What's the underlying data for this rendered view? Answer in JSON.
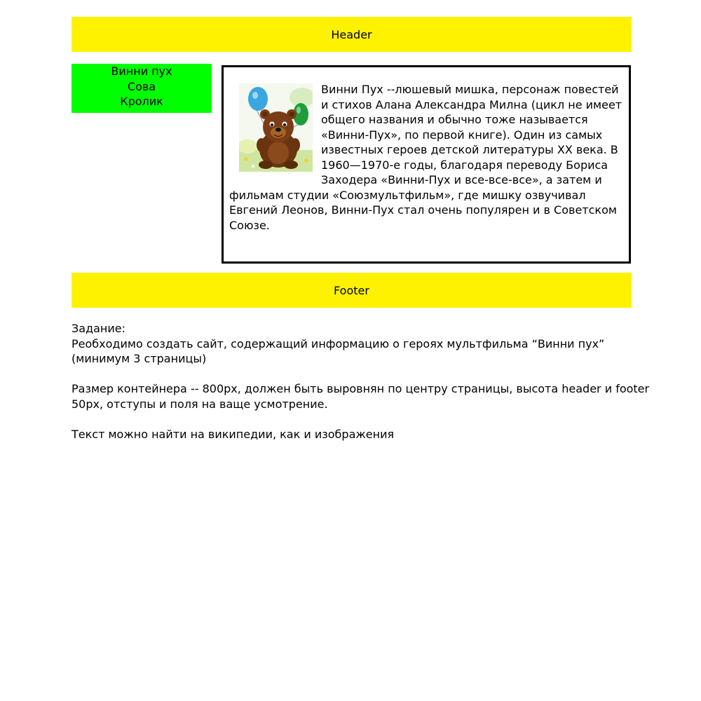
{
  "header": {
    "label": "Header"
  },
  "nav": {
    "items": [
      {
        "label": "Винни пух"
      },
      {
        "label": "Сова"
      },
      {
        "label": "Кролик"
      }
    ]
  },
  "content": {
    "image_icon": "winnie-pooh-illustration",
    "text": " Винни Пух --люшевый мишка, персонаж повестей и стихов Алана Александра Милна (цикл не имеет общего названия и обычно тоже называется «Винни-Пух», по первой книге). Один из самых известных героев детской литературы XX века. В 1960—1970-е годы, благодаря переводу Бориса Заходера «Винни-Пух и все-все-все», а затем и фильмам студии «Союзмультфильм», где мишку озвучивал Евгений Леонов, Винни-Пух стал очень популярен и в Советском Союзе."
  },
  "footer": {
    "label": "Footer"
  },
  "task": {
    "title": "Задание:",
    "line1": "Реобходимо создать сайт, содержащий информацию о героях мультфильма “Винни пух” (минимум 3 страницы)",
    "line2": "Размер контейнера -- 800px, должен быть выровнян по центру страницы, высота header и footer 50px, отступы и поля на ваще усмотрение.",
    "line3": "Текст можно найти на википедии, как и изображения"
  },
  "colors": {
    "header_bg": "#fff200",
    "nav_bg": "#00ff00",
    "content_border": "#000000"
  }
}
